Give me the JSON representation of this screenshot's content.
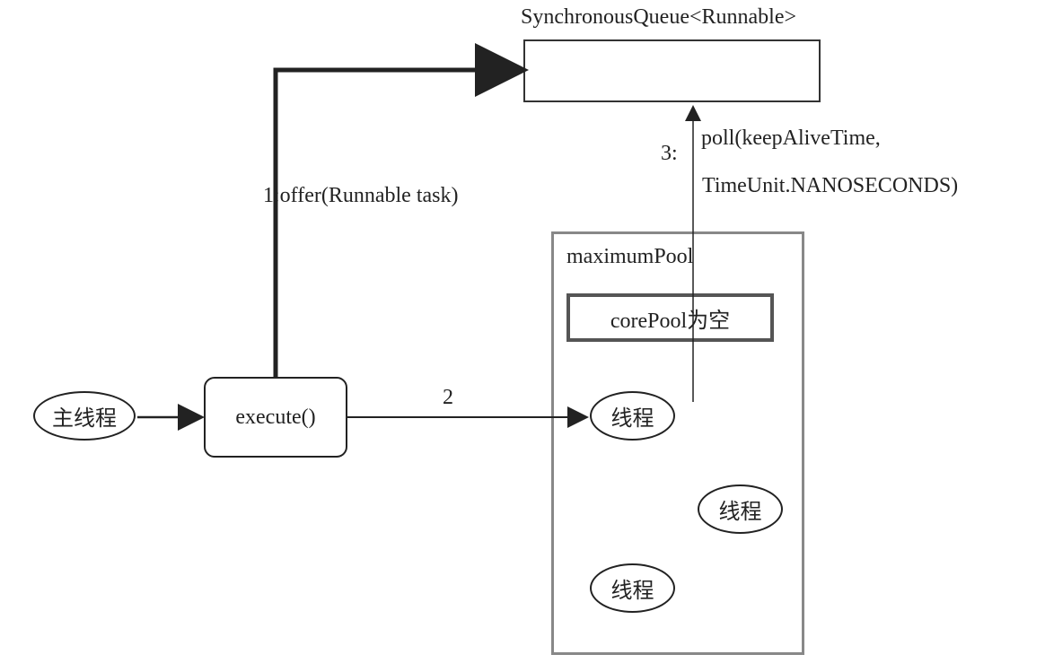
{
  "queue_title": "SynchronousQueue<Runnable>",
  "main_thread": "主线程",
  "execute_label": "execute()",
  "edge1_label": "1:offer(Runnable task)",
  "edge2_label": "2",
  "edge3_num": "3:",
  "edge3_line1": "poll(keepAliveTime,",
  "edge3_line2": "TimeUnit.NANOSECONDS)",
  "maximum_pool_label": "maximumPool",
  "core_pool_label": "corePool为空",
  "thread_label_1": "线程",
  "thread_label_2": "线程",
  "thread_label_3": "线程"
}
